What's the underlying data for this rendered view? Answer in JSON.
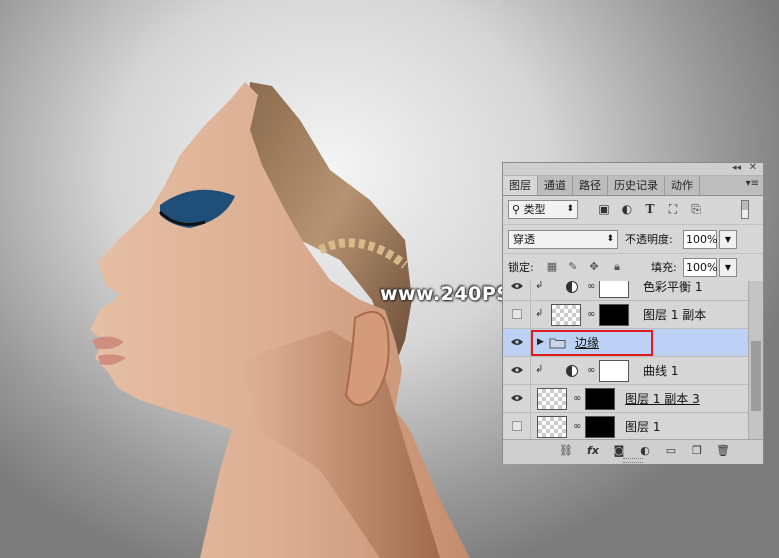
{
  "watermark": "www.240PS.com",
  "panel": {
    "tabs": [
      "图层",
      "通道",
      "路径",
      "历史记录",
      "动作"
    ],
    "filter": {
      "label": "类型"
    },
    "blend_mode": "穿透",
    "opacity": {
      "label": "不透明度:",
      "value": "100%"
    },
    "lock": {
      "label": "锁定:"
    },
    "fill": {
      "label": "填充:",
      "value": "100%"
    },
    "layers": [
      {
        "name": "色彩平衡 1",
        "visible": true
      },
      {
        "name": "图层 1 副本",
        "visible": false
      },
      {
        "name": "边缘",
        "visible": true,
        "group": true,
        "selected": true
      },
      {
        "name": "曲线 1",
        "visible": true
      },
      {
        "name": "图层 1 副本 3",
        "visible": true
      },
      {
        "name": "图层 1",
        "visible": false
      }
    ],
    "footer_icons": [
      "link-icon",
      "fx-icon",
      "mask-icon",
      "adjustment-icon",
      "folder-icon",
      "new-layer-icon",
      "trash-icon"
    ]
  },
  "colors": {
    "selected_row": "#bcd1f3",
    "highlight": "#e21c1c"
  }
}
